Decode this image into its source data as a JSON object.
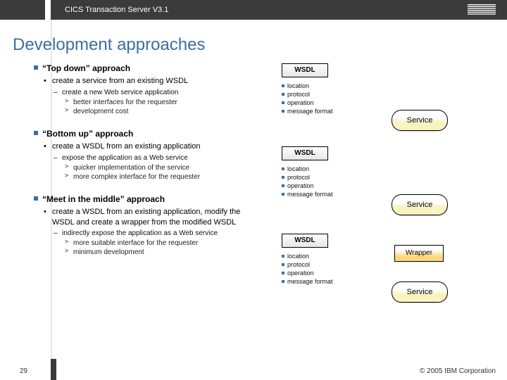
{
  "header": {
    "product": "CICS Transaction Server V3.1",
    "logo_alt": "IBM"
  },
  "title": "Development approaches",
  "attrs": [
    "location",
    "protocol",
    "operation",
    "message format"
  ],
  "boxes": {
    "wsdl": "WSDL",
    "service": "Service",
    "wrapper": "Wrapper"
  },
  "sections": [
    {
      "heading": "“Top down” approach",
      "b1": "create a service from an existing WSDL",
      "b2": "create a new Web service application",
      "b3": [
        "better interfaces for the requester",
        "development cost"
      ]
    },
    {
      "heading": "“Bottom up” approach",
      "b1": "create a WSDL from an existing application",
      "b2": "expose the application as a Web service",
      "b3": [
        "quicker implementation of the service",
        "more complex interface for the requester"
      ]
    },
    {
      "heading": "“Meet in the middle” approach",
      "b1": "create a WSDL from an existing application, modify the WSDL and create a wrapper from the modified WSDL",
      "b2": "indirectly expose the application as a Web service",
      "b3": [
        "more suitable interface for the requester",
        "minimum development"
      ]
    }
  ],
  "footer": {
    "page": "29",
    "copyright": "© 2005 IBM Corporation"
  }
}
